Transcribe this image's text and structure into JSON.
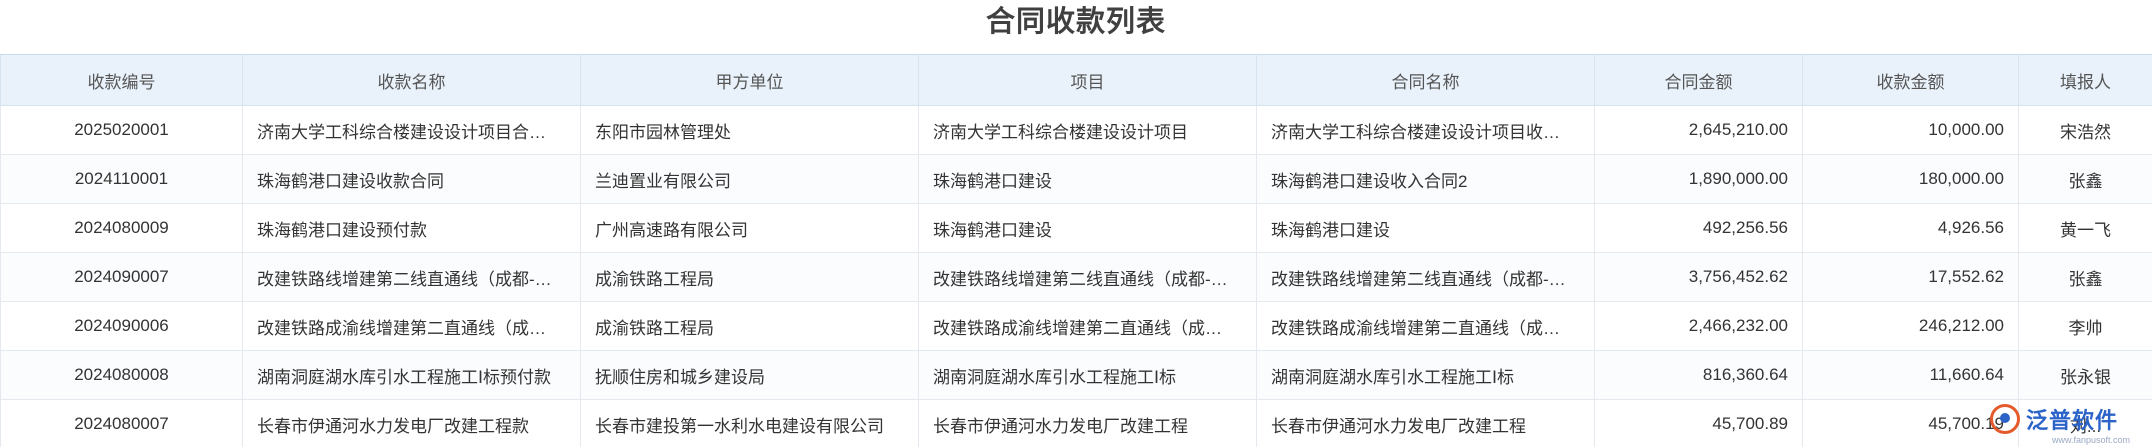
{
  "title": "合同收款列表",
  "columns": [
    "收款编号",
    "收款名称",
    "甲方单位",
    "项目",
    "合同名称",
    "合同金额",
    "收款金额",
    "填报人"
  ],
  "rows": [
    {
      "code": "2025020001",
      "name": "济南大学工科综合楼建设设计项目合…",
      "party": "东阳市园林管理处",
      "project": "济南大学工科综合楼建设设计项目",
      "contract": "济南大学工科综合楼建设设计项目收…",
      "contract_amount": "2,645,210.00",
      "received_amount": "10,000.00",
      "reporter": "宋浩然"
    },
    {
      "code": "2024110001",
      "name": "珠海鹤港口建设收款合同",
      "party": "兰迪置业有限公司",
      "project": "珠海鹤港口建设",
      "contract": "珠海鹤港口建设收入合同2",
      "contract_amount": "1,890,000.00",
      "received_amount": "180,000.00",
      "reporter": "张鑫"
    },
    {
      "code": "2024080009",
      "name": "珠海鹤港口建设预付款",
      "party": "广州高速路有限公司",
      "project": "珠海鹤港口建设",
      "contract": "珠海鹤港口建设",
      "contract_amount": "492,256.56",
      "received_amount": "4,926.56",
      "reporter": "黄一飞"
    },
    {
      "code": "2024090007",
      "name": "改建铁路线增建第二线直通线（成都-…",
      "party": "成渝铁路工程局",
      "project": "改建铁路线增建第二线直通线（成都-…",
      "contract": "改建铁路线增建第二线直通线（成都-…",
      "contract_amount": "3,756,452.62",
      "received_amount": "17,552.62",
      "reporter": "张鑫"
    },
    {
      "code": "2024090006",
      "name": "改建铁路成渝线增建第二直通线（成…",
      "party": "成渝铁路工程局",
      "project": "改建铁路成渝线增建第二直通线（成…",
      "contract": "改建铁路成渝线增建第二直通线（成…",
      "contract_amount": "2,466,232.00",
      "received_amount": "246,212.00",
      "reporter": "李帅"
    },
    {
      "code": "2024080008",
      "name": "湖南洞庭湖水库引水工程施工Ⅰ标预付款",
      "party": "抚顺住房和城乡建设局",
      "project": "湖南洞庭湖水库引水工程施工Ⅰ标",
      "contract": "湖南洞庭湖水库引水工程施工Ⅰ标",
      "contract_amount": "816,360.64",
      "received_amount": "11,660.64",
      "reporter": "张永银"
    },
    {
      "code": "2024080007",
      "name": "长春市伊通河水力发电厂改建工程款",
      "party": "长春市建投第一水利水电建设有限公司",
      "project": "长春市伊通河水力发电厂改建工程",
      "contract": "长春市伊通河水力发电厂改建工程",
      "contract_amount": "45,700.89",
      "received_amount": "45,700.19",
      "reporter": "刘..."
    }
  ],
  "watermark": {
    "brand": "泛普软件",
    "url": "www.fanpusoft.com",
    "logo_icon": "fanpu-logo-icon"
  }
}
